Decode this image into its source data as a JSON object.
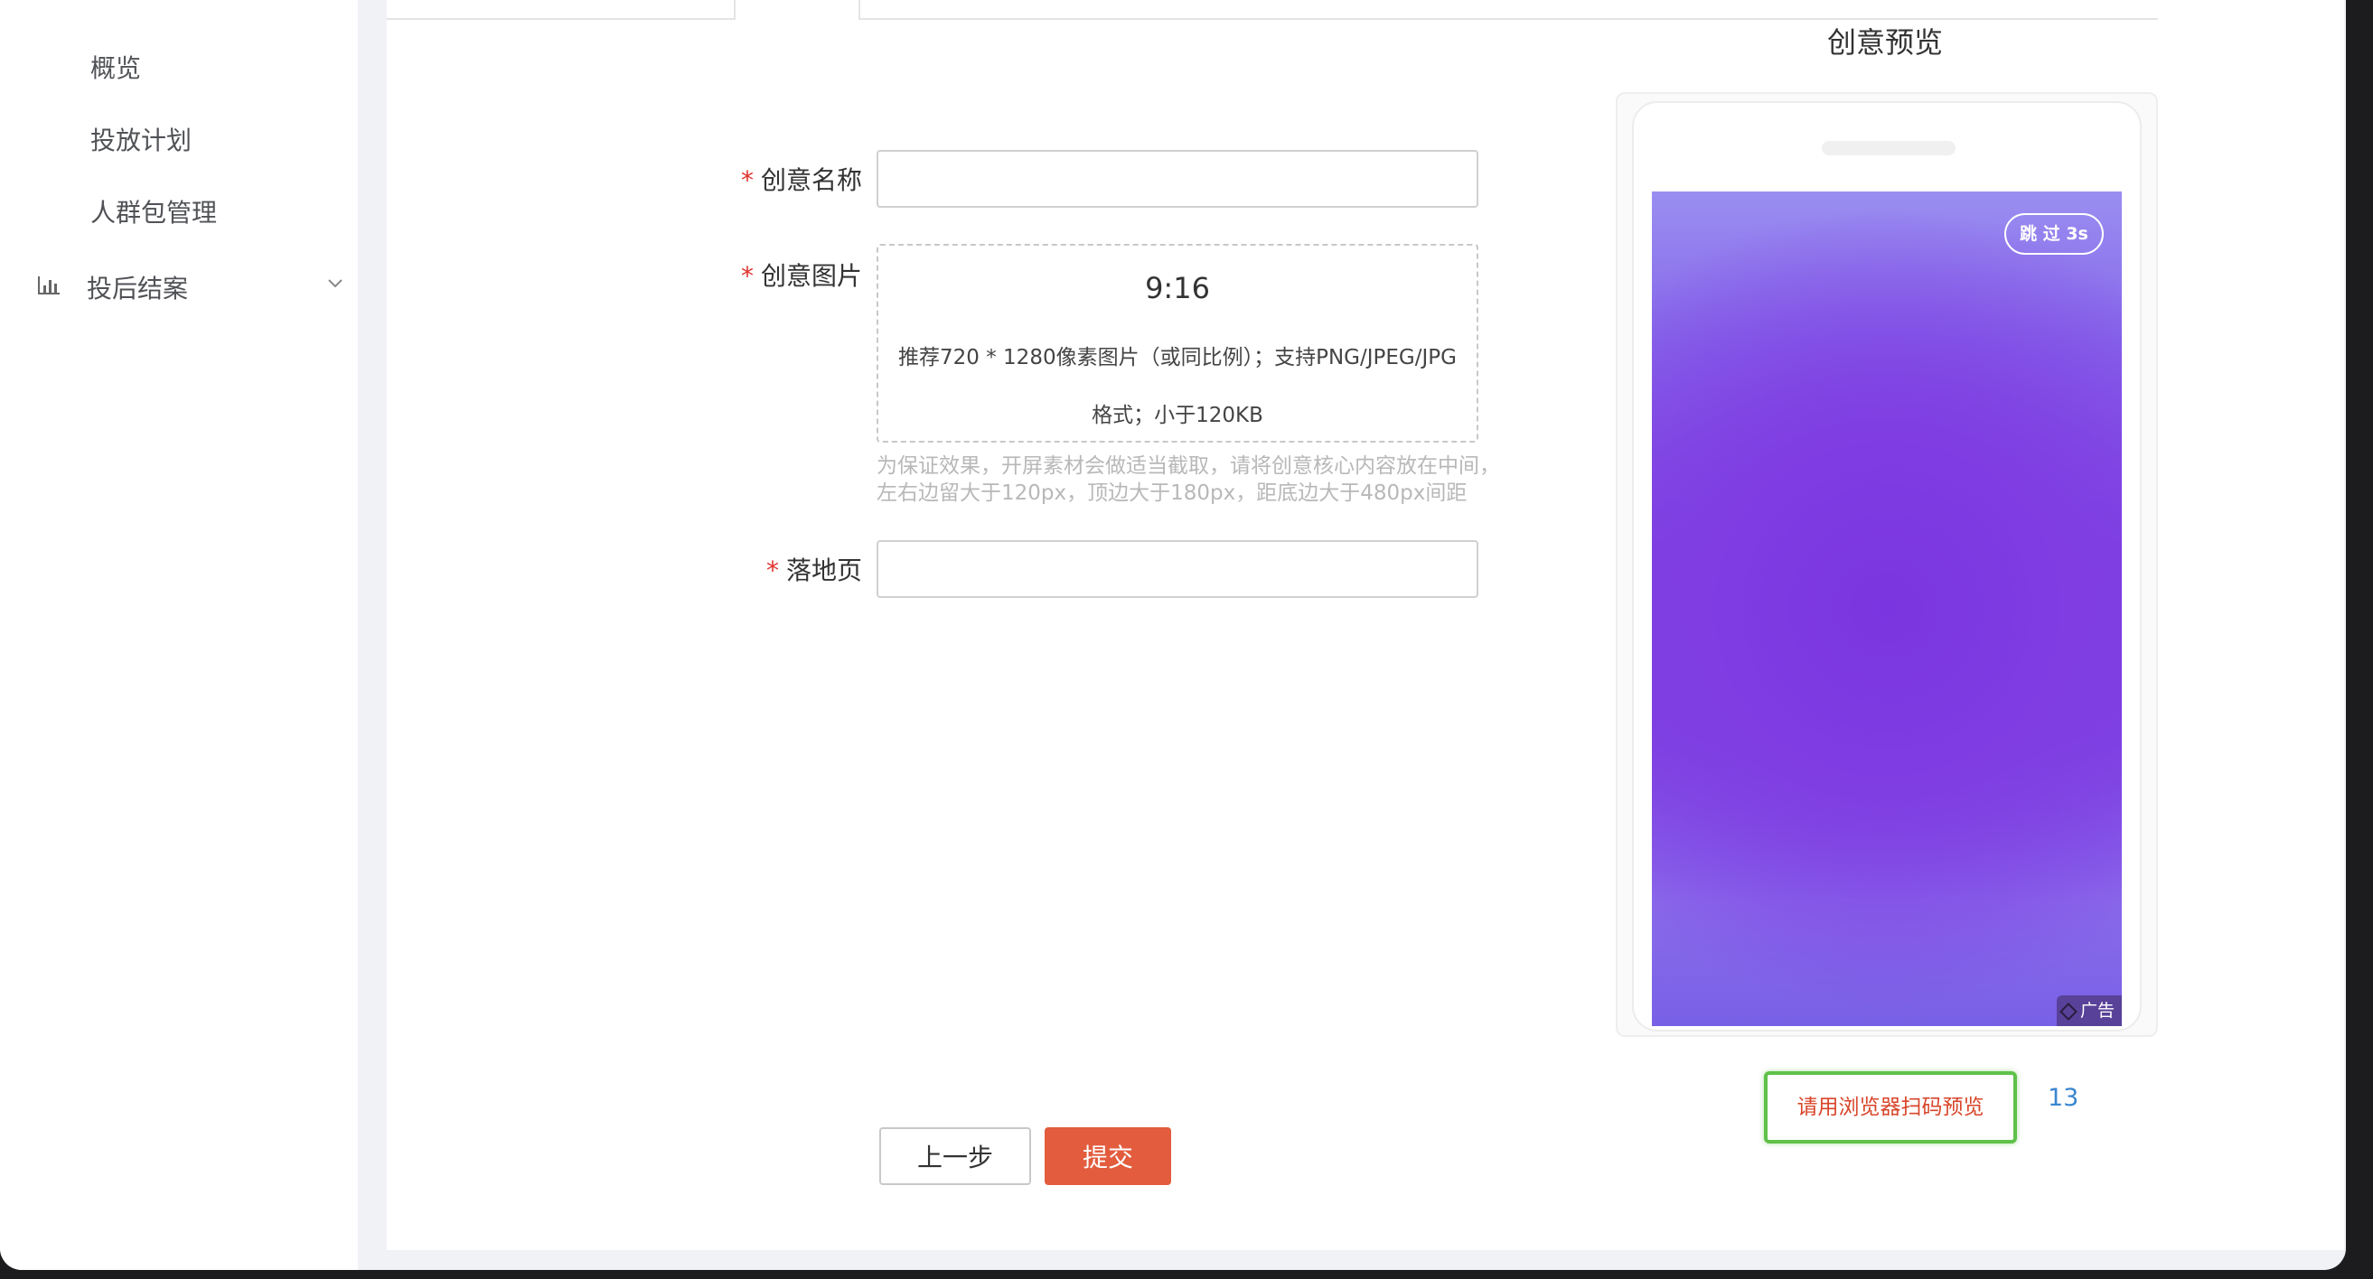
{
  "sidebar": {
    "items": [
      {
        "label": "概览"
      },
      {
        "label": "投放计划"
      },
      {
        "label": "人群包管理"
      }
    ],
    "group": {
      "label": "投后结案",
      "icon": "bar-chart-icon"
    }
  },
  "form": {
    "creative_name": {
      "label": "创意名称",
      "required_mark": "*",
      "value": ""
    },
    "creative_image": {
      "label": "创意图片",
      "required_mark": "*",
      "ratio": "9:16",
      "desc_line1": "推荐720 * 1280像素图片（或同比例）；支持PNG/JPEG/JPG",
      "desc_line2": "格式；小于120KB",
      "hint_line1": "为保证效果，开屏素材会做适当截取，请将创意核心内容放在中间，",
      "hint_line2": "左右边留大于120px，顶边大于180px，距底边大于480px间距"
    },
    "landing_page": {
      "label": "落地页",
      "required_mark": "*",
      "value": ""
    },
    "prev_button": "上一步",
    "submit_button": "提交"
  },
  "preview": {
    "title": "创意预览",
    "skip_label": "跳 过 3s",
    "ad_badge": "广告",
    "scan_prompt": "请用浏览器扫码预览",
    "scan_count": "13"
  },
  "colors": {
    "accent": "#e25c3d",
    "required": "#e0332d",
    "link": "#3a86d0",
    "scan_border": "#5fc149",
    "preview_purple": "#7e3fe3"
  }
}
